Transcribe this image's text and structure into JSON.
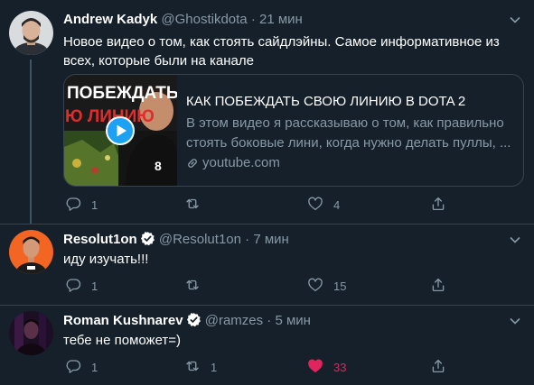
{
  "tweets": [
    {
      "name": "Andrew Kadyk",
      "handle": "@Ghostikdota",
      "sep": "·",
      "time": "21 мин",
      "text": "Новое видео о том, как стоять сайдлэйны. Самое информативное из всех, которые были на канале",
      "card": {
        "thumb_text_1": "ПОБЕЖДАТЬ",
        "thumb_text_2": "Ю ЛИНИЮ",
        "title": "КАК ПОБЕЖДАТЬ СВОЮ ЛИНИЮ В DOTA 2",
        "description": "В этом видео я рассказываю о том, как правильно стоять боковые лини, когда нужно делать пуллы, ...",
        "domain": "youtube.com"
      },
      "replies": "1",
      "retweets": "",
      "likes": "4"
    },
    {
      "name": "Resolut1on",
      "handle": "@Resolut1on",
      "sep": "·",
      "time": "7 мин",
      "verified": true,
      "text": "иду изучать!!!",
      "replies": "1",
      "retweets": "",
      "likes": "15"
    },
    {
      "name": "Roman Kushnarev",
      "handle": "@ramzes",
      "sep": "·",
      "time": "5 мин",
      "verified": true,
      "text": "тебе не поможет=)",
      "replies": "1",
      "retweets": "1",
      "likes": "33",
      "liked": true
    }
  ],
  "colors": {
    "background": "#15202b",
    "border": "#38444d",
    "secondary_text": "#8899a6",
    "verified": "#1da1f2",
    "like_active": "#e0245e"
  },
  "icons": [
    "reply-icon",
    "retweet-icon",
    "like-icon",
    "share-icon",
    "caret-down-icon",
    "verified-badge-icon",
    "link-icon",
    "play-icon"
  ]
}
